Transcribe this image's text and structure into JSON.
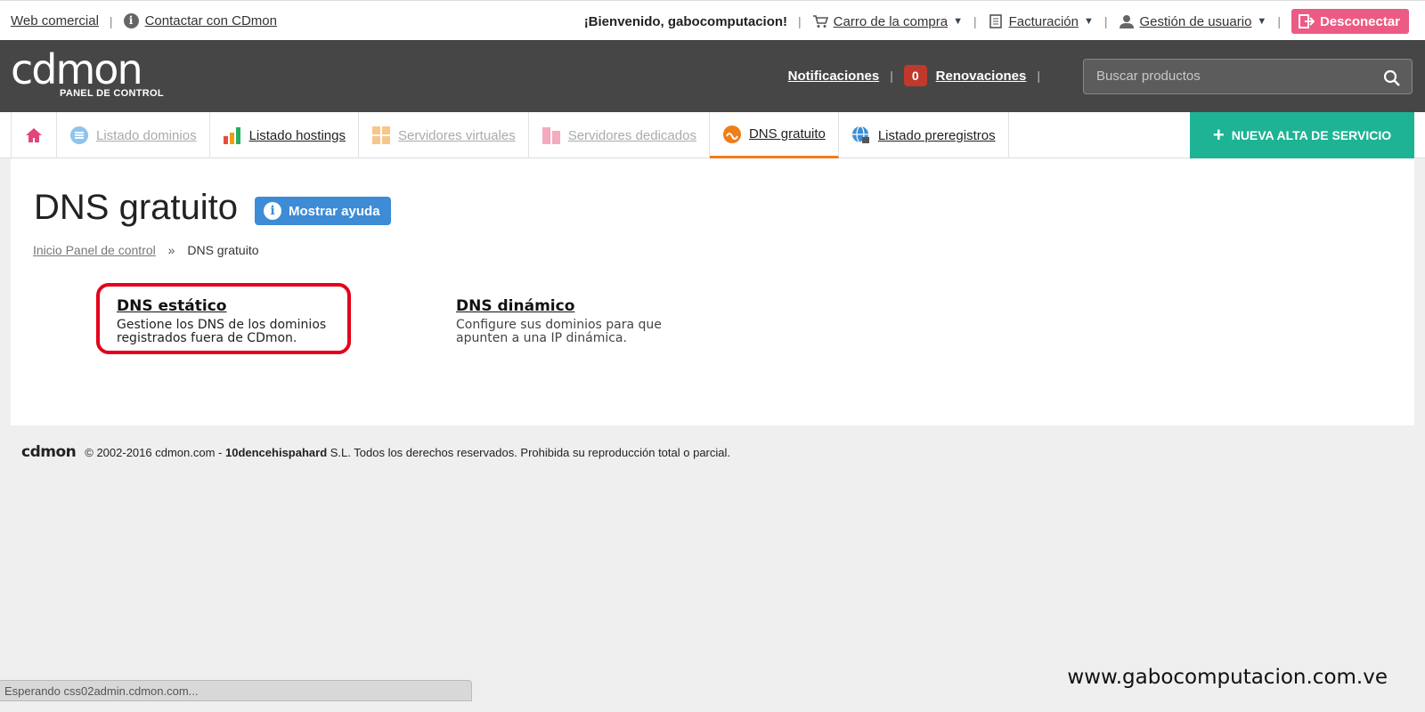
{
  "topbar": {
    "commercial_link": "Web comercial",
    "contact_link": "Contactar con CDmon",
    "welcome": "¡Bienvenido, gabocomputacion!",
    "cart": "Carro de la compra",
    "billing": "Facturación",
    "user_mgmt": "Gestión de usuario",
    "logout": "Desconectar"
  },
  "header": {
    "logo_text": "cdmon",
    "logo_sub": "PANEL DE CONTROL",
    "notifications": "Notificaciones",
    "renewals_count": "0",
    "renewals": "Renovaciones",
    "search_placeholder": "Buscar productos"
  },
  "tabs": [
    {
      "label": "Listado dominios"
    },
    {
      "label": "Listado hostings"
    },
    {
      "label": "Servidores virtuales"
    },
    {
      "label": "Servidores dedicados"
    },
    {
      "label": "DNS gratuito"
    },
    {
      "label": "Listado preregistros"
    }
  ],
  "new_service": "NUEVA ALTA DE SERVICIO",
  "page": {
    "title": "DNS gratuito",
    "help_button": "Mostrar ayuda",
    "breadcrumb_home": "Inicio Panel de control",
    "breadcrumb_sep": "»",
    "breadcrumb_current": "DNS gratuito"
  },
  "options": {
    "static": {
      "title": "DNS estático",
      "desc": "Gestione los DNS de los dominios registrados fuera de CDmon."
    },
    "dynamic": {
      "title": "DNS dinámico",
      "desc": "Configure sus dominios para que apunten a una IP dinámica."
    }
  },
  "footer": {
    "logo": "cdmon",
    "copyright": "© 2002-2016 cdmon.com -",
    "company": "10dencehispahard",
    "rights": "S.L. Todos los derechos reservados. Prohibida su reproducción total o parcial."
  },
  "status_bar": "Esperando css02admin.cdmon.com...",
  "watermark": "www.gabocomputacion.com.ve",
  "colors": {
    "header_bg": "#464646",
    "accent_green": "#1eb394",
    "logout_pink": "#ec5b84",
    "help_blue": "#3e8bd6",
    "active_tab_orange": "#f07d1a",
    "highlight_red": "#e3001b"
  }
}
